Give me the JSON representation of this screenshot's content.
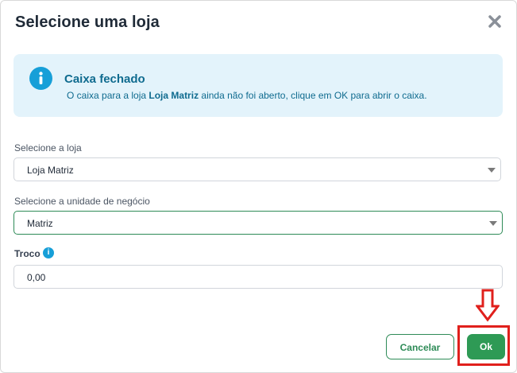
{
  "dialog": {
    "title": "Selecione uma loja"
  },
  "alert": {
    "title": "Caixa fechado",
    "message_before": "O caixa para a loja ",
    "message_store": "Loja Matriz",
    "message_after": " ainda não foi aberto, clique em OK para abrir o caixa."
  },
  "fields": {
    "store_label": "Selecione a loja",
    "store_value": "Loja Matriz",
    "unit_label": "Selecione a unidade de negócio",
    "unit_value": "Matriz",
    "troco_label": "Troco",
    "troco_info": "i",
    "troco_value": "0,00"
  },
  "buttons": {
    "cancel": "Cancelar",
    "ok": "Ok"
  },
  "colors": {
    "accent_green": "#2e9a55",
    "info_blue": "#179fd8",
    "alert_bg": "#e3f3fb",
    "highlight_red": "#e0201c"
  },
  "icons": {
    "close": "close-icon",
    "info": "info-icon",
    "caret": "chevron-down-icon",
    "annotation_arrow": "arrow-down-icon"
  }
}
